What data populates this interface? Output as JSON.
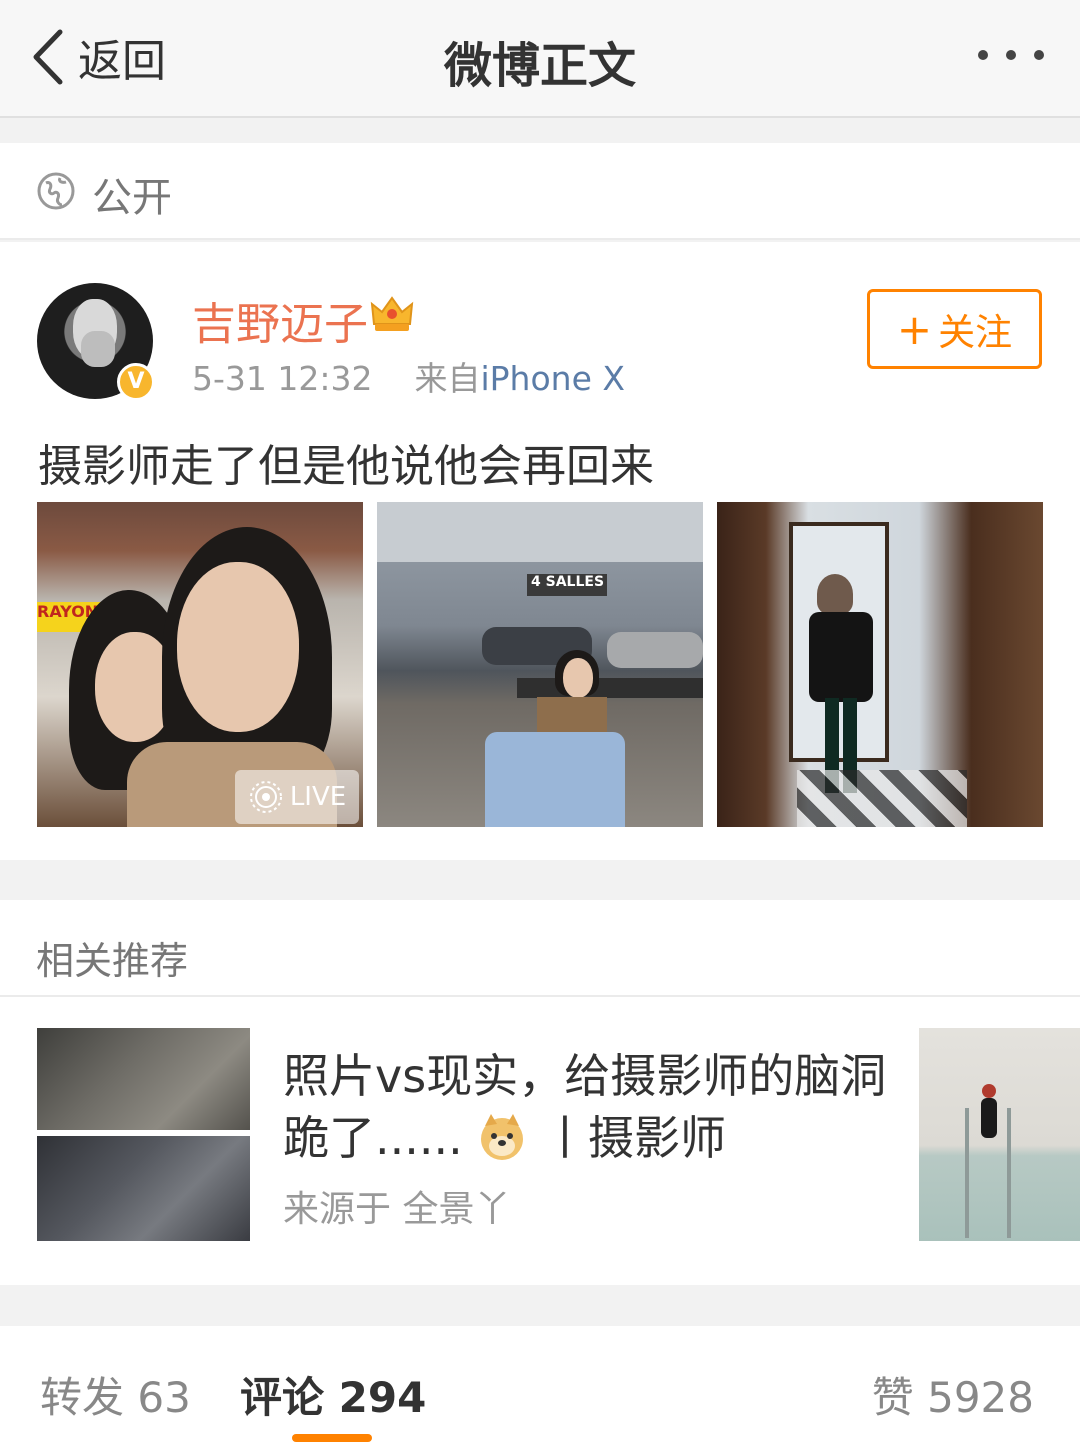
{
  "navbar": {
    "back_label": "返回",
    "title": "微博正文",
    "more_icon": "more-dots-icon"
  },
  "visibility": {
    "icon": "globe-icon",
    "label": "公开"
  },
  "post": {
    "username": "吉野迈子",
    "username_color": "#eb7350",
    "member_icon": "crown-icon",
    "verified_badge": "V",
    "time": "5-31 12:32",
    "source_prefix": "来自",
    "device": "iPhone X",
    "follow_label": "关注",
    "text": "摄影师走了但是他说他会再回来",
    "images": [
      {
        "kind": "photo",
        "live_label": "LIVE",
        "sign_text": "RAYON D'O"
      },
      {
        "kind": "photo",
        "sign_text": "4 SALLES"
      },
      {
        "kind": "photo"
      }
    ]
  },
  "recommend": {
    "header": "相关推荐",
    "title_part1": "照片vs现实，给摄影师的脑洞跪了......",
    "emoji_icon": "doge-emoji-icon",
    "title_part2": "丨摄影师",
    "source": "来源于 全景丫"
  },
  "actions": {
    "repost_label": "转发",
    "repost_count": "63",
    "comment_label": "评论",
    "comment_count": "294",
    "like_label": "赞",
    "like_count": "5928",
    "accent": "#ff8200"
  }
}
